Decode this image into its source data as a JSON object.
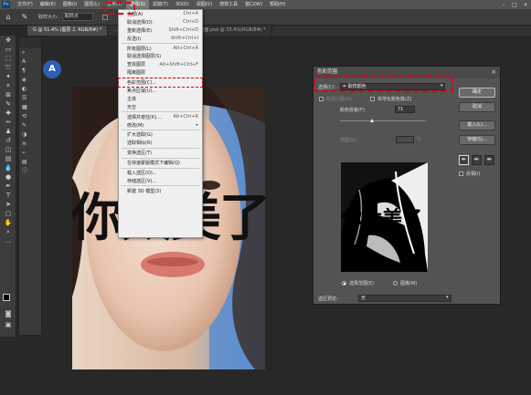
{
  "app": {
    "logo": "Ps"
  },
  "menubar": {
    "items": [
      "文件(F)",
      "编辑(E)",
      "图像(I)",
      "图层(L)",
      "文字(Y)",
      "选择(S)",
      "滤镜(T)",
      "3D(D)",
      "视图(V)",
      "增效工具",
      "窗口(W)",
      "帮助(H)"
    ],
    "active_index": 5
  },
  "options": {
    "sample_label": "取样大小:",
    "sample_value": "取样点"
  },
  "tabs": [
    {
      "label": "G @ 51.4% (图层 2, RGB/8#) *"
    },
    {
      "label": "... RGB/8#) * ×"
    },
    {
      "label": "75姐想分享-小红书封面.psd @ 33.4%(RGB/8#) *"
    }
  ],
  "select_menu": {
    "items": [
      {
        "label": "全部(A)",
        "shortcut": "Ctrl+A"
      },
      {
        "label": "取消选择(D)",
        "shortcut": "Ctrl+D"
      },
      {
        "label": "重新选择(E)",
        "shortcut": "Shift+Ctrl+D"
      },
      {
        "label": "反选(I)",
        "shortcut": "Shift+Ctrl+I"
      },
      {
        "sep": true
      },
      {
        "label": "所有图层(L)",
        "shortcut": "Alt+Ctrl+A"
      },
      {
        "label": "取消选择图层(S)",
        "shortcut": ""
      },
      {
        "label": "查找图层",
        "shortcut": "Alt+Shift+Ctrl+F"
      },
      {
        "label": "隔离图层",
        "shortcut": ""
      },
      {
        "sep": true
      },
      {
        "label": "色彩范围(C)...",
        "shortcut": "",
        "highlight": true
      },
      {
        "label": "焦点区域(U)...",
        "shortcut": ""
      },
      {
        "label": "主体",
        "shortcut": ""
      },
      {
        "label": "天空",
        "shortcut": ""
      },
      {
        "sep": true
      },
      {
        "label": "选择并遮住(K)...",
        "shortcut": "Alt+Ctrl+R"
      },
      {
        "label": "修改(M)",
        "shortcut": "▸"
      },
      {
        "sep": true
      },
      {
        "label": "扩大选取(G)",
        "shortcut": ""
      },
      {
        "label": "选取相似(R)",
        "shortcut": ""
      },
      {
        "sep": true
      },
      {
        "label": "变换选区(T)",
        "shortcut": ""
      },
      {
        "sep": true
      },
      {
        "label": "在快速蒙版模式下编辑(Q)",
        "shortcut": ""
      },
      {
        "sep": true
      },
      {
        "label": "载入选区(O)...",
        "shortcut": ""
      },
      {
        "label": "存储选区(V)...",
        "shortcut": ""
      },
      {
        "sep": true
      },
      {
        "label": "新建 3D 模型(3)",
        "shortcut": ""
      }
    ]
  },
  "canvas": {
    "text": "你太美了"
  },
  "dialog": {
    "title": "色彩范围",
    "select_label": "选择(C):",
    "select_value": "取样颜色",
    "detect_faces": "检测人脸(D)",
    "localized": "本地化颜色簇(Z)",
    "fuzziness_label": "颜色容差(F):",
    "fuzziness_value": "71",
    "range_label": "范围(R):",
    "range_unit": "%",
    "preview_text": "你太美了",
    "radio_selection": "选择范围(E)",
    "radio_image": "图像(M)",
    "ok": "确定",
    "cancel": "取消",
    "load": "载入(L)...",
    "save": "存储(S)...",
    "invert": "反相(I)",
    "preview_label": "选区预览:",
    "preview_value": "无"
  }
}
